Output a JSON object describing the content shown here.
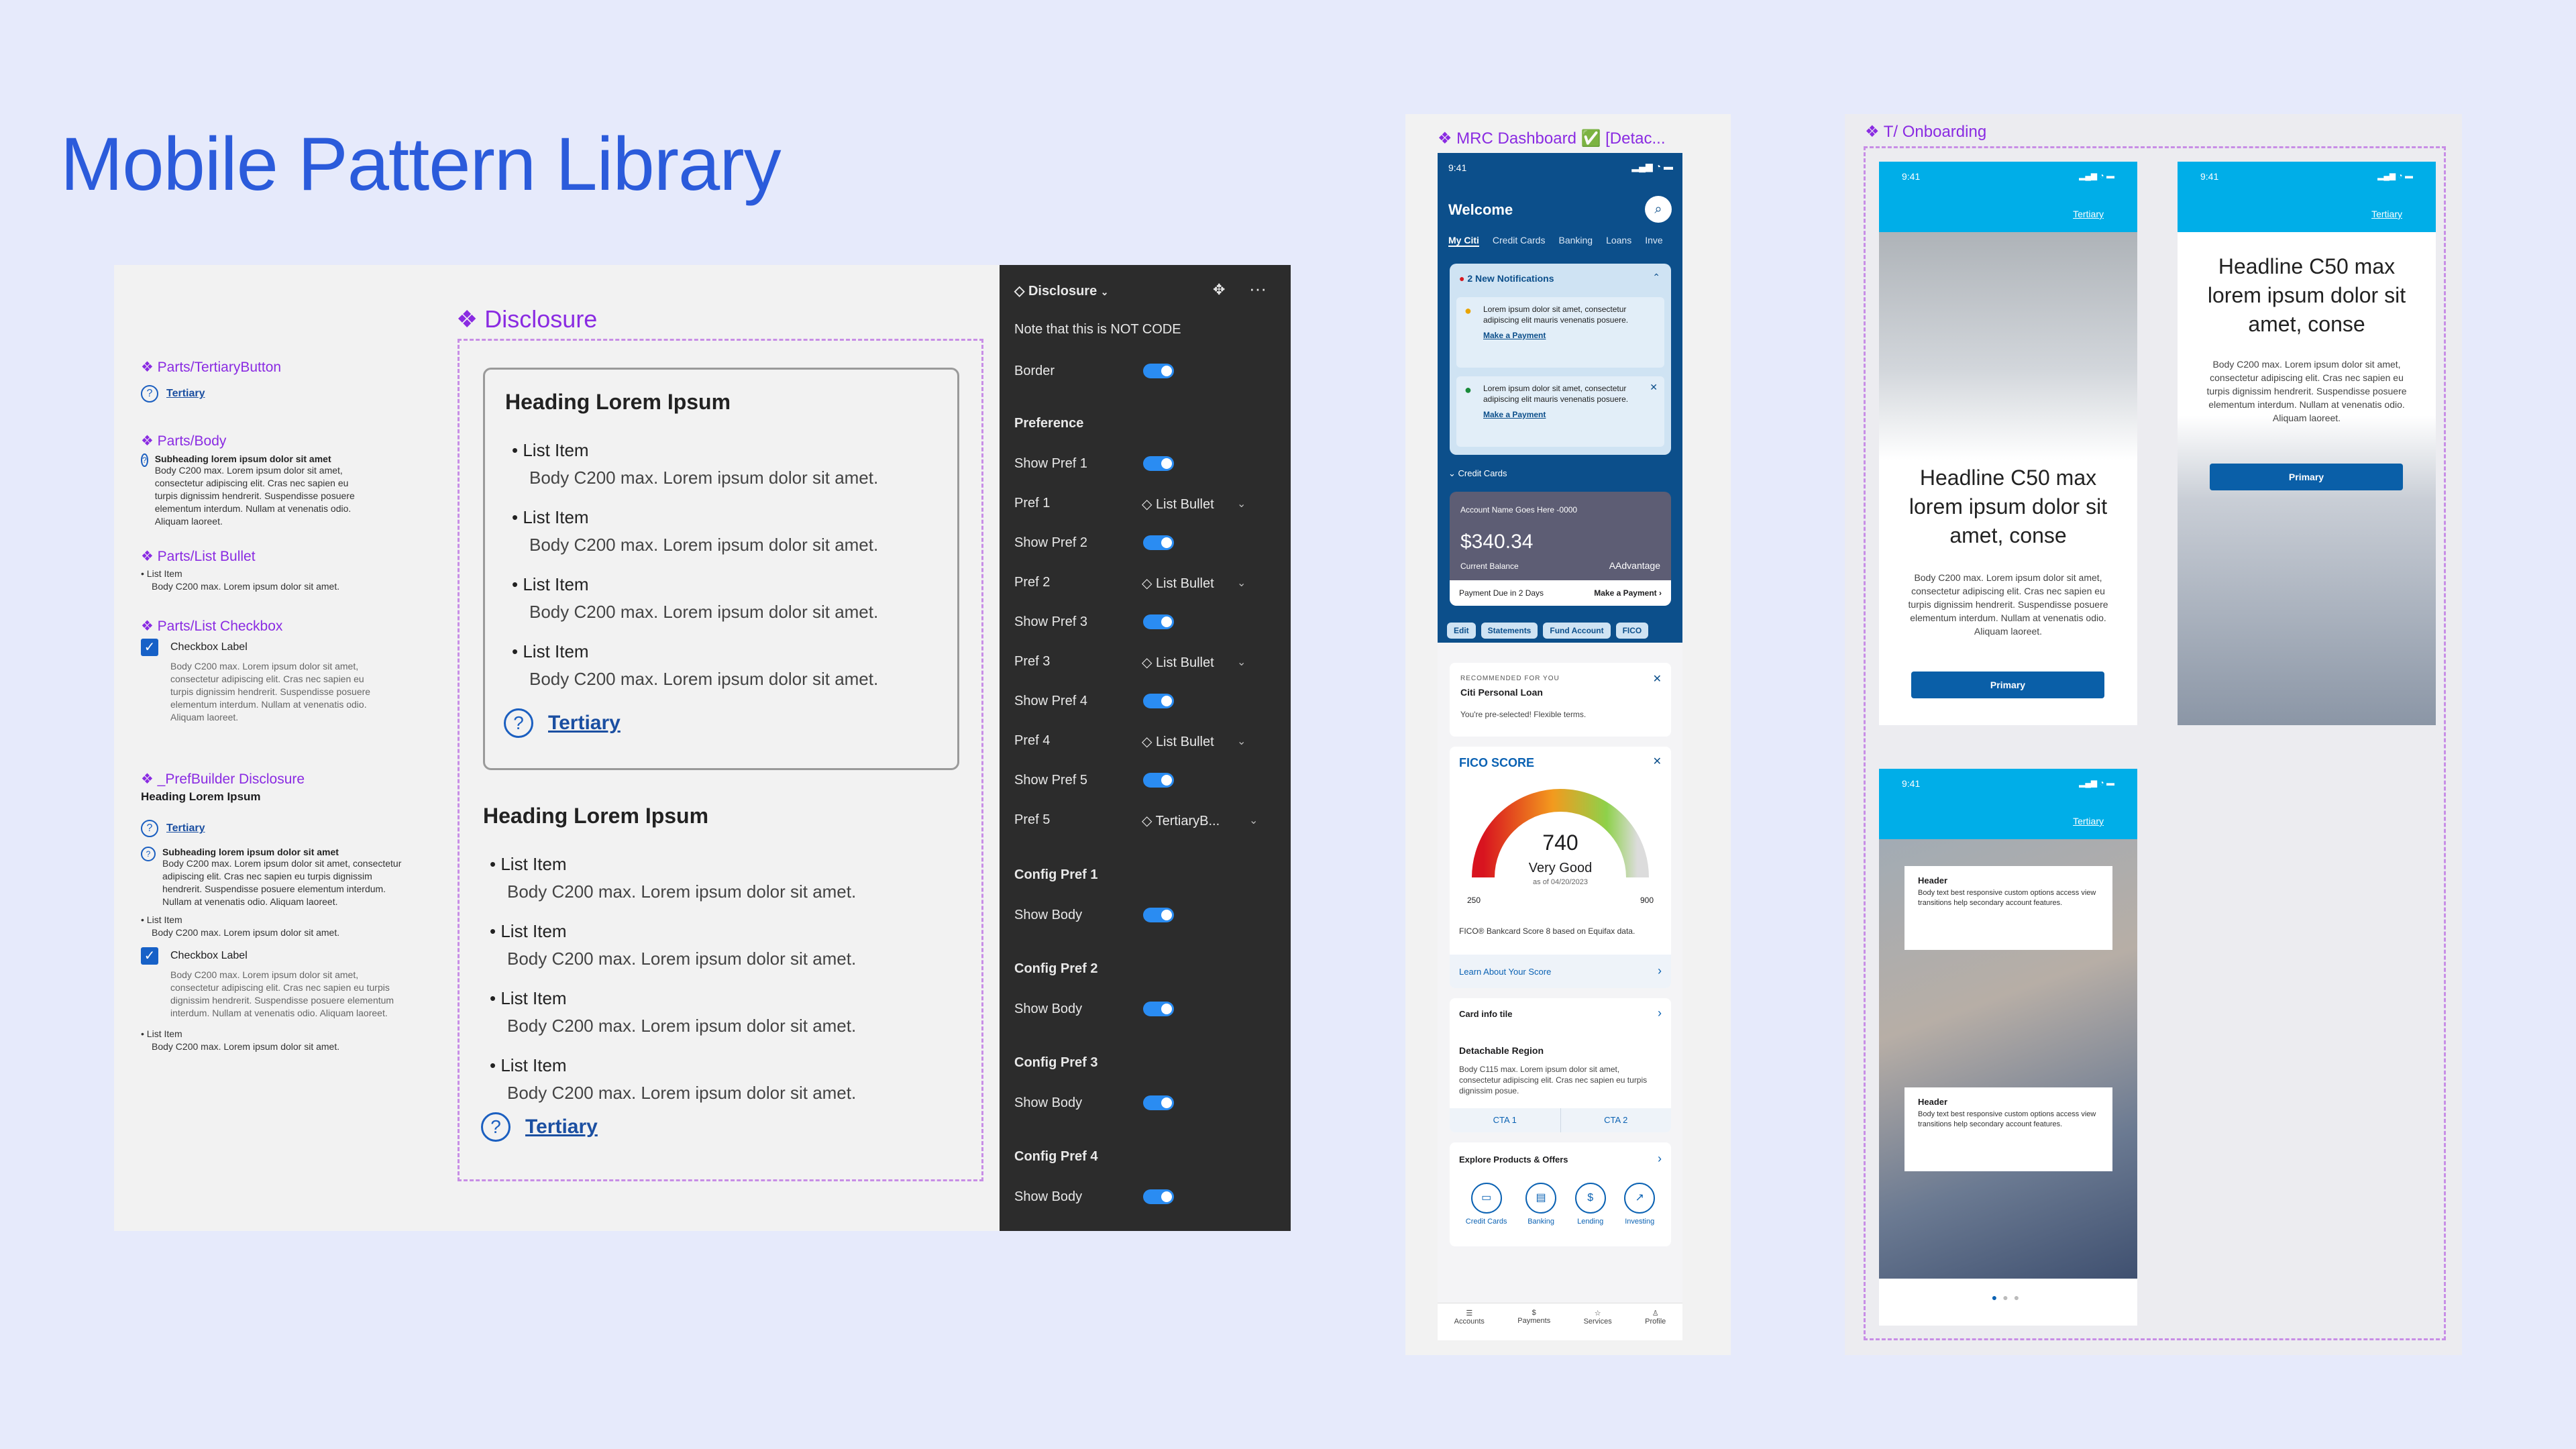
{
  "page_title": "Mobile Pattern Library",
  "parts": {
    "tertiary_button": {
      "title": "❖ Parts/TertiaryButton",
      "label": "Tertiary"
    },
    "body": {
      "title": "❖ Parts/Body",
      "subheading": "Subheading lorem ipsum dolor sit amet",
      "text": "Body C200 max. Lorem ipsum dolor sit amet, consectetur adipiscing elit. Cras nec sapien eu turpis dignissim hendrerit. Suspendisse posuere elementum interdum. Nullam at venenatis odio. Aliquam laoreet."
    },
    "list_bullet": {
      "title": "❖ Parts/List Bullet",
      "item": "List Item",
      "body": "Body C200 max. Lorem ipsum dolor sit amet."
    },
    "list_checkbox": {
      "title": "❖ Parts/List Checkbox",
      "label": "Checkbox Label",
      "body": "Body C200 max. Lorem ipsum dolor sit amet, consectetur adipiscing elit. Cras nec sapien eu turpis dignissim hendrerit. Suspendisse posuere elementum interdum. Nullam at venenatis odio. Aliquam laoreet."
    },
    "prefbuilder": {
      "title": "❖ _PrefBuilder Disclosure",
      "heading": "Heading Lorem Ipsum",
      "tertiary": "Tertiary",
      "subheading": "Subheading lorem ipsum dolor sit amet",
      "body": "Body C200 max. Lorem ipsum dolor sit amet, consectetur adipiscing elit. Cras nec sapien eu turpis dignissim hendrerit. Suspendisse posuere elementum interdum. Nullam at venenatis odio. Aliquam laoreet.",
      "list_item": "List Item",
      "list_body": "Body C200 max. Lorem ipsum dolor sit amet.",
      "checkbox_label": "Checkbox Label",
      "checkbox_body": "Body C200 max. Lorem ipsum dolor sit amet, consectetur adipiscing elit. Cras nec sapien eu turpis dignissim hendrerit. Suspendisse posuere elementum interdum. Nullam at venenatis odio. Aliquam laoreet.",
      "list_item2": "List Item",
      "list_body2": "Body C200 max. Lorem ipsum dolor sit amet."
    }
  },
  "disclosure": {
    "title": "❖ Disclosure",
    "heading": "Heading Lorem Ipsum",
    "items": [
      {
        "title": "List Item",
        "body": "Body C200 max. Lorem ipsum dolor sit amet."
      },
      {
        "title": "List Item",
        "body": "Body C200 max. Lorem ipsum dolor sit amet."
      },
      {
        "title": "List Item",
        "body": "Body C200 max. Lorem ipsum dolor sit amet."
      },
      {
        "title": "List Item",
        "body": "Body C200 max. Lorem ipsum dolor sit amet."
      }
    ],
    "tertiary": "Tertiary"
  },
  "panel": {
    "component": "Disclosure",
    "note": "Note that this is NOT CODE",
    "border_label": "Border",
    "preference_label": "Preference",
    "rows": [
      {
        "label": "Show Pref 1"
      },
      {
        "label": "Pref 1",
        "value": "List Bullet"
      },
      {
        "label": "Show Pref 2"
      },
      {
        "label": "Pref 2",
        "value": "List Bullet"
      },
      {
        "label": "Show Pref 3"
      },
      {
        "label": "Pref 3",
        "value": "List Bullet"
      },
      {
        "label": "Show Pref 4"
      },
      {
        "label": "Pref 4",
        "value": "List Bullet"
      },
      {
        "label": "Show Pref 5"
      },
      {
        "label": "Pref 5",
        "value": "TertiaryB..."
      }
    ],
    "configs": [
      {
        "title": "Config Pref 1",
        "label": "Show Body"
      },
      {
        "title": "Config Pref 2",
        "label": "Show Body"
      },
      {
        "title": "Config Pref 3",
        "label": "Show Body"
      },
      {
        "title": "Config Pref 4",
        "label": "Show Body"
      }
    ]
  },
  "mrc": {
    "title": "❖ MRC Dashboard ✅ [Detac...",
    "time": "9:41",
    "welcome": "Welcome",
    "tabs": [
      "My Citi",
      "Credit Cards",
      "Banking",
      "Loans",
      "Inve"
    ],
    "notif_title": "2 New Notifications",
    "notif1": "Lorem ipsum dolor sit amet, consectetur adipiscing elit mauris venenatis posuere.",
    "notif1_link": "Make a Payment",
    "notif2": "Lorem ipsum dolor sit amet, consectetur adipiscing elit mauris venenatis posuere.",
    "notif2_link": "Make a Payment",
    "credit_cards": "Credit Cards",
    "account_name": "Account Name Goes Here -0000",
    "balance": "$340.34",
    "balance_label": "Current Balance",
    "brand": "AAdvantage",
    "payment_due": "Payment Due in 2 Days",
    "make_payment": "Make a Payment",
    "chips": [
      "Edit",
      "Statements",
      "Fund Account",
      "FICO"
    ],
    "reco_label": "RECOMMENDED FOR YOU",
    "reco_title": "Citi Personal Loan",
    "reco_body": "You're pre-selected! Flexible terms.",
    "fico_logo": "FICO SCORE",
    "fico_score": "740",
    "fico_rating": "Very Good",
    "fico_date": "as of 04/20/2023",
    "fico_min": "250",
    "fico_max": "900",
    "fico_note": "FICO® Bankcard Score 8 based on Equifax data.",
    "fico_link": "Learn About Your Score",
    "card_info": "Card info tile",
    "detach_title": "Detachable Region",
    "detach_body": "Body C115 max. Lorem ipsum dolor sit amet, consectetur adipiscing elit. Cras nec sapien eu turpis dignissim posue.",
    "cta1": "CTA 1",
    "cta2": "CTA 2",
    "explore": "Explore Products & Offers",
    "products": [
      "Credit Cards",
      "Banking",
      "Lending",
      "Investing"
    ],
    "nav": [
      "Accounts",
      "Payments",
      "Services",
      "Profile"
    ]
  },
  "onboarding": {
    "title": "❖ T/ Onboarding",
    "time": "9:41",
    "tertiary": "Tertiary",
    "s1_headline": "Headline C50 max lorem ipsum dolor sit amet, conse",
    "s1_body": "Body C200 max. Lorem ipsum dolor sit amet, consectetur adipiscing elit. Cras nec sapien eu turpis dignissim hendrerit. Suspendisse posuere elementum interdum. Nullam at venenatis odio. Aliquam laoreet.",
    "s1_button": "Primary",
    "s2_headline": "Headline C50 max lorem ipsum dolor sit amet, conse",
    "s2_body": "Body C200 max. Lorem ipsum dolor sit amet, consectetur adipiscing elit. Cras nec sapien eu turpis dignissim hendrerit. Suspendisse posuere elementum interdum. Nullam at venenatis odio. Aliquam laoreet.",
    "s2_button": "Primary",
    "tip1_header": "Header",
    "tip1_body": "Body text best responsive custom options access view transitions help secondary account features.",
    "tip2_header": "Header",
    "tip2_body": "Body text best responsive custom options access view transitions help secondary account features."
  },
  "colors": {
    "accent": "#2b5bdb",
    "brand_purple": "#8a2be2",
    "citi_blue": "#0a5fa8",
    "sky": "#00aee8",
    "toggle": "#2a8cf2"
  }
}
